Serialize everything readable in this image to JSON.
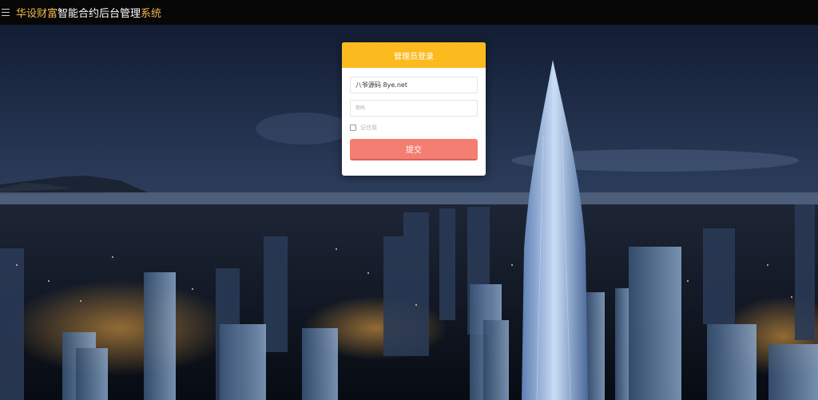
{
  "header": {
    "menu_icon": "hamburger-icon",
    "brand_part1": "华设财富",
    "brand_part2": "智能合约后台管理",
    "brand_part3": "系统",
    "colors": {
      "bar": "#070707",
      "accent": "#f0b84b",
      "text": "#ffffff"
    }
  },
  "login": {
    "title": "管理员登录",
    "username_value": "八爷源码 8ye.net",
    "password_placeholder": "密码",
    "remember_label": "记住我",
    "remember_checked": false,
    "submit_label": "提交",
    "colors": {
      "header": "#fbbb1e",
      "submit": "#f37e71"
    }
  },
  "background": {
    "subject": "night-city-skyline"
  }
}
